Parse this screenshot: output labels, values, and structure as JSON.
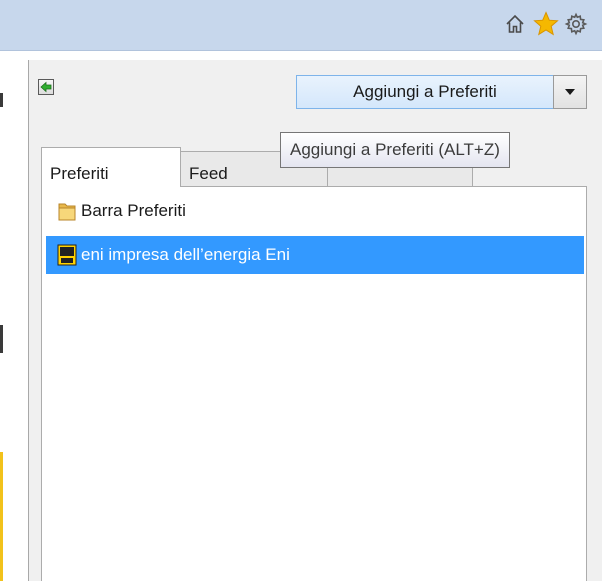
{
  "toolbar": {
    "icons": [
      "home-icon",
      "favorites-star-icon",
      "settings-gear-icon"
    ],
    "star_color": "#f5b800"
  },
  "favorites_panel": {
    "pin_icon": "pin-arrow-icon",
    "add_button_label": "Aggiungi a Preferiti",
    "dropdown_icon": "caret-down-icon",
    "tooltip_text": "Aggiungi a Preferiti (ALT+Z)",
    "tabs": [
      {
        "label": "Preferiti",
        "active": true
      },
      {
        "label": "Feed",
        "active": false
      },
      {
        "label": "",
        "active": false
      }
    ],
    "items": [
      {
        "label": "Barra Preferiti",
        "icon": "folder-icon",
        "selected": false
      },
      {
        "label": "eni impresa dell’energia  Eni",
        "icon": "eni-site-icon",
        "selected": true
      }
    ],
    "selection_color": "#3399ff"
  }
}
